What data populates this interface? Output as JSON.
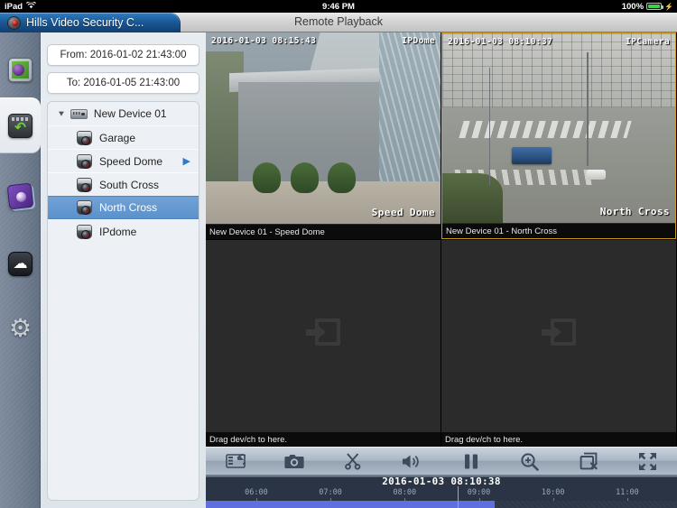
{
  "status_bar": {
    "device": "iPad",
    "wifi_icon": "wifi-icon",
    "time": "9:46 PM",
    "battery_percent": "100%",
    "charging_icon": "lightning-bolt-icon"
  },
  "title_bar": {
    "app_tab_label": "Hills Video Security C...",
    "app_tab_icon": "app-logo-icon",
    "window_title": "Remote Playback"
  },
  "rail": {
    "items": [
      {
        "name": "live-view",
        "icon": "live-view-icon",
        "selected": false
      },
      {
        "name": "remote-playback",
        "icon": "remote-playback-icon",
        "selected": true
      },
      {
        "name": "pictures-videos",
        "icon": "photo-album-icon",
        "selected": false
      },
      {
        "name": "cloud",
        "icon": "cloud-icon",
        "selected": false
      },
      {
        "name": "configuration",
        "icon": "gear-icon",
        "selected": false
      }
    ]
  },
  "device_panel": {
    "from_field": {
      "label": "From:",
      "value": "2016-01-02 21:43:00",
      "text": "From: 2016-01-02 21:43:00"
    },
    "to_field": {
      "label": "To:",
      "value": "2016-01-05 21:43:00",
      "text": "To: 2016-01-05 21:43:00"
    },
    "tree": [
      {
        "type": "device",
        "label": "New Device 01",
        "icon": "dvr-icon",
        "expanded": true,
        "selected": false,
        "has_arrow": false
      },
      {
        "type": "camera",
        "label": "Garage",
        "icon": "camera-icon",
        "selected": false,
        "has_arrow": false
      },
      {
        "type": "camera",
        "label": "Speed Dome",
        "icon": "camera-icon",
        "selected": false,
        "has_arrow": true
      },
      {
        "type": "camera",
        "label": "South Cross",
        "icon": "camera-icon",
        "selected": false,
        "has_arrow": false
      },
      {
        "type": "camera",
        "label": "North Cross",
        "icon": "camera-icon",
        "selected": true,
        "has_arrow": false
      },
      {
        "type": "camera",
        "label": "IPdome",
        "icon": "camera-icon",
        "selected": false,
        "has_arrow": false
      }
    ]
  },
  "video_grid": {
    "cells": [
      {
        "occupied": true,
        "selected": false,
        "osd_timestamp": "2016-01-03 08:15:43",
        "osd_channel": "IPDome",
        "osd_watermark": "Speed Dome",
        "label": "New Device 01 - Speed Dome"
      },
      {
        "occupied": true,
        "selected": true,
        "osd_timestamp": "2016-01-03 08:10:37",
        "osd_channel": "IPCamera",
        "osd_watermark": "North Cross",
        "label": "New Device 01 - North Cross"
      },
      {
        "occupied": false,
        "selected": false,
        "label": "Drag dev/ch to here.",
        "drop_icon": "drag-drop-icon"
      },
      {
        "occupied": false,
        "selected": false,
        "label": "Drag dev/ch to here.",
        "drop_icon": "drag-drop-icon"
      }
    ]
  },
  "toolbar": {
    "buttons": [
      {
        "name": "reverse-playback-button",
        "icon": "reverse-playback-icon"
      },
      {
        "name": "snapshot-button",
        "icon": "camera-icon"
      },
      {
        "name": "clip-button",
        "icon": "scissors-icon"
      },
      {
        "name": "audio-button",
        "icon": "speaker-icon"
      },
      {
        "name": "pause-button",
        "icon": "pause-icon"
      },
      {
        "name": "digital-zoom-button",
        "icon": "magnifier-plus-icon"
      },
      {
        "name": "close-all-button",
        "icon": "close-window-icon"
      },
      {
        "name": "fullscreen-button",
        "icon": "fullscreen-icon"
      }
    ]
  },
  "timeline": {
    "current_time": "2016-01-03 08:10:38",
    "ticks": [
      "06:00",
      "07:00",
      "08:00",
      "09:00",
      "10:00",
      "11:00"
    ],
    "recording_color": "#5f6fe0",
    "cursor_color": "#e0a513",
    "recording_end_fraction": 0.613,
    "cursor_fraction": 0.534
  }
}
